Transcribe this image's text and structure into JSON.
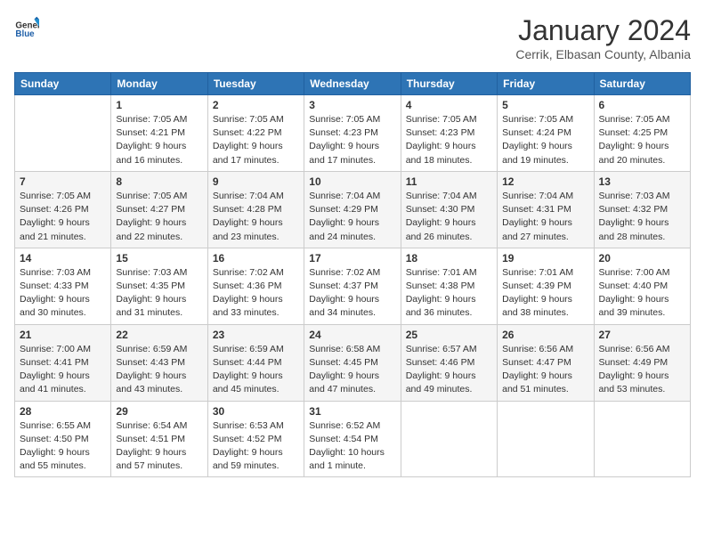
{
  "header": {
    "logo_general": "General",
    "logo_blue": "Blue",
    "month_title": "January 2024",
    "location": "Cerrik, Elbasan County, Albania"
  },
  "weekdays": [
    "Sunday",
    "Monday",
    "Tuesday",
    "Wednesday",
    "Thursday",
    "Friday",
    "Saturday"
  ],
  "weeks": [
    [
      {
        "day": "",
        "sunrise": "",
        "sunset": "",
        "daylight": ""
      },
      {
        "day": "1",
        "sunrise": "Sunrise: 7:05 AM",
        "sunset": "Sunset: 4:21 PM",
        "daylight": "Daylight: 9 hours and 16 minutes."
      },
      {
        "day": "2",
        "sunrise": "Sunrise: 7:05 AM",
        "sunset": "Sunset: 4:22 PM",
        "daylight": "Daylight: 9 hours and 17 minutes."
      },
      {
        "day": "3",
        "sunrise": "Sunrise: 7:05 AM",
        "sunset": "Sunset: 4:23 PM",
        "daylight": "Daylight: 9 hours and 17 minutes."
      },
      {
        "day": "4",
        "sunrise": "Sunrise: 7:05 AM",
        "sunset": "Sunset: 4:23 PM",
        "daylight": "Daylight: 9 hours and 18 minutes."
      },
      {
        "day": "5",
        "sunrise": "Sunrise: 7:05 AM",
        "sunset": "Sunset: 4:24 PM",
        "daylight": "Daylight: 9 hours and 19 minutes."
      },
      {
        "day": "6",
        "sunrise": "Sunrise: 7:05 AM",
        "sunset": "Sunset: 4:25 PM",
        "daylight": "Daylight: 9 hours and 20 minutes."
      }
    ],
    [
      {
        "day": "7",
        "sunrise": "Sunrise: 7:05 AM",
        "sunset": "Sunset: 4:26 PM",
        "daylight": "Daylight: 9 hours and 21 minutes."
      },
      {
        "day": "8",
        "sunrise": "Sunrise: 7:05 AM",
        "sunset": "Sunset: 4:27 PM",
        "daylight": "Daylight: 9 hours and 22 minutes."
      },
      {
        "day": "9",
        "sunrise": "Sunrise: 7:04 AM",
        "sunset": "Sunset: 4:28 PM",
        "daylight": "Daylight: 9 hours and 23 minutes."
      },
      {
        "day": "10",
        "sunrise": "Sunrise: 7:04 AM",
        "sunset": "Sunset: 4:29 PM",
        "daylight": "Daylight: 9 hours and 24 minutes."
      },
      {
        "day": "11",
        "sunrise": "Sunrise: 7:04 AM",
        "sunset": "Sunset: 4:30 PM",
        "daylight": "Daylight: 9 hours and 26 minutes."
      },
      {
        "day": "12",
        "sunrise": "Sunrise: 7:04 AM",
        "sunset": "Sunset: 4:31 PM",
        "daylight": "Daylight: 9 hours and 27 minutes."
      },
      {
        "day": "13",
        "sunrise": "Sunrise: 7:03 AM",
        "sunset": "Sunset: 4:32 PM",
        "daylight": "Daylight: 9 hours and 28 minutes."
      }
    ],
    [
      {
        "day": "14",
        "sunrise": "Sunrise: 7:03 AM",
        "sunset": "Sunset: 4:33 PM",
        "daylight": "Daylight: 9 hours and 30 minutes."
      },
      {
        "day": "15",
        "sunrise": "Sunrise: 7:03 AM",
        "sunset": "Sunset: 4:35 PM",
        "daylight": "Daylight: 9 hours and 31 minutes."
      },
      {
        "day": "16",
        "sunrise": "Sunrise: 7:02 AM",
        "sunset": "Sunset: 4:36 PM",
        "daylight": "Daylight: 9 hours and 33 minutes."
      },
      {
        "day": "17",
        "sunrise": "Sunrise: 7:02 AM",
        "sunset": "Sunset: 4:37 PM",
        "daylight": "Daylight: 9 hours and 34 minutes."
      },
      {
        "day": "18",
        "sunrise": "Sunrise: 7:01 AM",
        "sunset": "Sunset: 4:38 PM",
        "daylight": "Daylight: 9 hours and 36 minutes."
      },
      {
        "day": "19",
        "sunrise": "Sunrise: 7:01 AM",
        "sunset": "Sunset: 4:39 PM",
        "daylight": "Daylight: 9 hours and 38 minutes."
      },
      {
        "day": "20",
        "sunrise": "Sunrise: 7:00 AM",
        "sunset": "Sunset: 4:40 PM",
        "daylight": "Daylight: 9 hours and 39 minutes."
      }
    ],
    [
      {
        "day": "21",
        "sunrise": "Sunrise: 7:00 AM",
        "sunset": "Sunset: 4:41 PM",
        "daylight": "Daylight: 9 hours and 41 minutes."
      },
      {
        "day": "22",
        "sunrise": "Sunrise: 6:59 AM",
        "sunset": "Sunset: 4:43 PM",
        "daylight": "Daylight: 9 hours and 43 minutes."
      },
      {
        "day": "23",
        "sunrise": "Sunrise: 6:59 AM",
        "sunset": "Sunset: 4:44 PM",
        "daylight": "Daylight: 9 hours and 45 minutes."
      },
      {
        "day": "24",
        "sunrise": "Sunrise: 6:58 AM",
        "sunset": "Sunset: 4:45 PM",
        "daylight": "Daylight: 9 hours and 47 minutes."
      },
      {
        "day": "25",
        "sunrise": "Sunrise: 6:57 AM",
        "sunset": "Sunset: 4:46 PM",
        "daylight": "Daylight: 9 hours and 49 minutes."
      },
      {
        "day": "26",
        "sunrise": "Sunrise: 6:56 AM",
        "sunset": "Sunset: 4:47 PM",
        "daylight": "Daylight: 9 hours and 51 minutes."
      },
      {
        "day": "27",
        "sunrise": "Sunrise: 6:56 AM",
        "sunset": "Sunset: 4:49 PM",
        "daylight": "Daylight: 9 hours and 53 minutes."
      }
    ],
    [
      {
        "day": "28",
        "sunrise": "Sunrise: 6:55 AM",
        "sunset": "Sunset: 4:50 PM",
        "daylight": "Daylight: 9 hours and 55 minutes."
      },
      {
        "day": "29",
        "sunrise": "Sunrise: 6:54 AM",
        "sunset": "Sunset: 4:51 PM",
        "daylight": "Daylight: 9 hours and 57 minutes."
      },
      {
        "day": "30",
        "sunrise": "Sunrise: 6:53 AM",
        "sunset": "Sunset: 4:52 PM",
        "daylight": "Daylight: 9 hours and 59 minutes."
      },
      {
        "day": "31",
        "sunrise": "Sunrise: 6:52 AM",
        "sunset": "Sunset: 4:54 PM",
        "daylight": "Daylight: 10 hours and 1 minute."
      },
      {
        "day": "",
        "sunrise": "",
        "sunset": "",
        "daylight": ""
      },
      {
        "day": "",
        "sunrise": "",
        "sunset": "",
        "daylight": ""
      },
      {
        "day": "",
        "sunrise": "",
        "sunset": "",
        "daylight": ""
      }
    ]
  ]
}
